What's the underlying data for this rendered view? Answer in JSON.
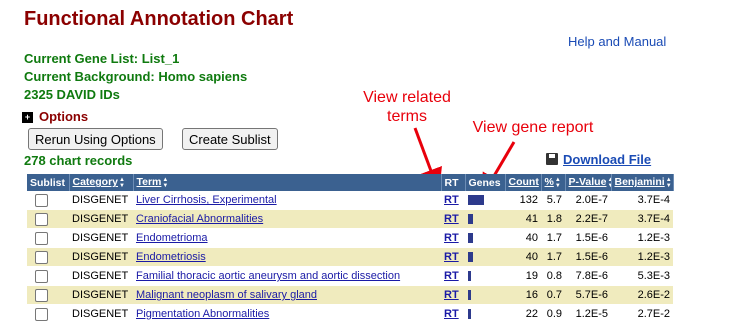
{
  "header": {
    "title": "Functional Annotation Chart",
    "help_link": "Help and Manual",
    "gene_list": "Current Gene List: List_1",
    "background": "Current Background: Homo sapiens",
    "ids": "2325 DAVID IDs",
    "options_label": "Options",
    "options_icon": "plus-icon"
  },
  "buttons": {
    "rerun": "Rerun Using Options",
    "sublist": "Create Sublist"
  },
  "records": "278 chart records",
  "download": {
    "label": "Download File",
    "icon": "floppy-disk-icon"
  },
  "annotations": {
    "related_terms": "View related\nterms",
    "gene_report": "View gene report",
    "color": "#e8000b"
  },
  "table": {
    "columns": [
      "Sublist",
      "Category",
      "Term",
      "RT",
      "Genes",
      "Count",
      "%",
      "P-Value",
      "Benjamini"
    ],
    "rows": [
      {
        "category": "DISGENET",
        "term": "Liver Cirrhosis, Experimental",
        "rt": "RT",
        "gene_fraction": 1.0,
        "count": "132",
        "percent": "5.7",
        "pvalue": "2.0E-7",
        "benjamini": "3.7E-4"
      },
      {
        "category": "DISGENET",
        "term": "Craniofacial Abnormalities",
        "rt": "RT",
        "gene_fraction": 0.3,
        "count": "41",
        "percent": "1.8",
        "pvalue": "2.2E-7",
        "benjamini": "3.7E-4"
      },
      {
        "category": "DISGENET",
        "term": "Endometrioma",
        "rt": "RT",
        "gene_fraction": 0.3,
        "count": "40",
        "percent": "1.7",
        "pvalue": "1.5E-6",
        "benjamini": "1.2E-3"
      },
      {
        "category": "DISGENET",
        "term": "Endometriosis",
        "rt": "RT",
        "gene_fraction": 0.3,
        "count": "40",
        "percent": "1.7",
        "pvalue": "1.5E-6",
        "benjamini": "1.2E-3"
      },
      {
        "category": "DISGENET",
        "term": "Familial thoracic aortic aneurysm and aortic dissection",
        "rt": "RT",
        "gene_fraction": 0.15,
        "count": "19",
        "percent": "0.8",
        "pvalue": "7.8E-6",
        "benjamini": "5.3E-3"
      },
      {
        "category": "DISGENET",
        "term": "Malignant neoplasm of salivary gland",
        "rt": "RT",
        "gene_fraction": 0.12,
        "count": "16",
        "percent": "0.7",
        "pvalue": "5.7E-6",
        "benjamini": "2.6E-2"
      },
      {
        "category": "DISGENET",
        "term": "Pigmentation Abnormalities",
        "rt": "RT",
        "gene_fraction": 0.15,
        "count": "22",
        "percent": "0.9",
        "pvalue": "1.2E-5",
        "benjamini": "2.7E-2"
      }
    ]
  },
  "colors": {
    "title": "#8b0000",
    "info_green": "#0f7a0f",
    "link_blue": "#1a4bb5",
    "header_bg": "#3b6190",
    "row_alt": "#f0ebbe",
    "gene_bar": "#2d3a8c"
  }
}
